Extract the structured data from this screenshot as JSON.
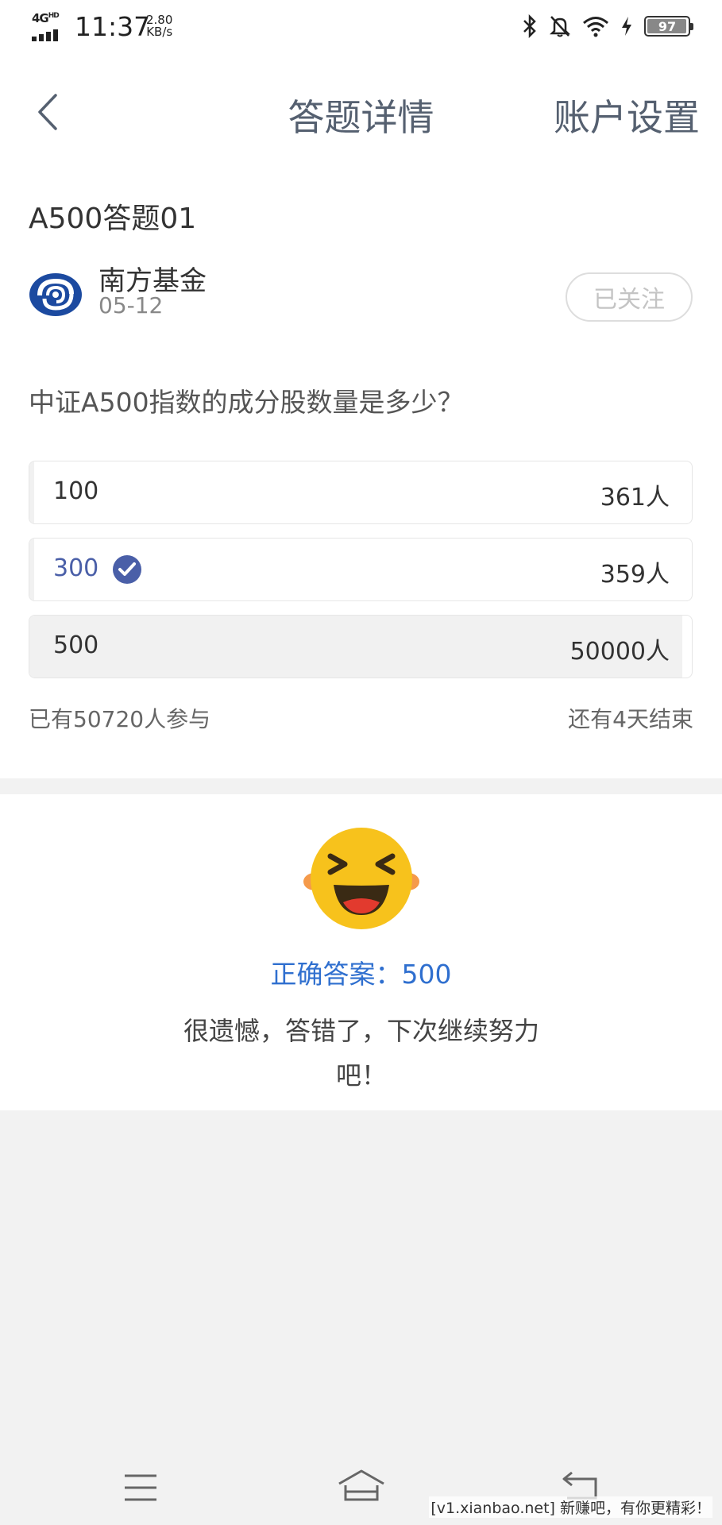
{
  "status_bar": {
    "network": "4G",
    "network_sup": "HD",
    "time": "11:37",
    "speed_value": "2.80",
    "speed_unit": "KB/s",
    "battery": "97"
  },
  "header": {
    "title": "答题详情",
    "settings_label": "账户设置"
  },
  "quiz": {
    "title": "A500答题01",
    "org_name": "南方基金",
    "date": "05-12",
    "follow_label": "已关注",
    "question": "中证A500指数的成分股数量是多少？",
    "options": [
      {
        "label": "100",
        "count": "361人",
        "selected": false,
        "fill_percent": 0.7
      },
      {
        "label": "300",
        "count": "359人",
        "selected": true,
        "fill_percent": 0.7
      },
      {
        "label": "500",
        "count": "50000人",
        "selected": false,
        "fill_percent": 98.6
      }
    ],
    "participants": "已有50720人参与",
    "remaining": "还有4天结束"
  },
  "result": {
    "correct_answer": "正确答案：500",
    "message": "很遗憾，答错了，下次继续努力吧！"
  },
  "colors": {
    "accent_blue": "#2f6fcf",
    "selected_text": "#4a5fa8",
    "check_badge": "#4a5fa8",
    "emoji_face": "#f7c21c"
  },
  "icons": [
    "back-chevron-icon",
    "fund-logo",
    "check-badge-icon",
    "laughing-emoji",
    "menu-icon",
    "home-icon",
    "nav-back-icon"
  ],
  "watermark": "[v1.xianbao.net] 新赚吧，有你更精彩！"
}
